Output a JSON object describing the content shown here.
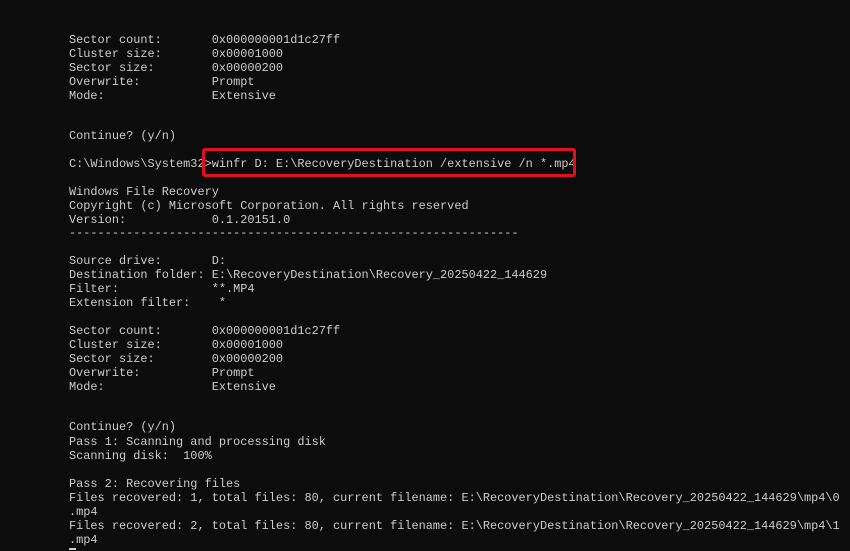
{
  "terminal": {
    "lines": [
      "Sector count:       0x000000001d1c27ff",
      "Cluster size:       0x00001000",
      "Sector size:        0x00000200",
      "Overwrite:          Prompt",
      "Mode:               Extensive",
      "Continue? (y/n)",
      "C:\\Windows\\System32>winfr D: E:\\RecoveryDestination /extensive /n *.mp4",
      "Windows File Recovery",
      "Copyright (c) Microsoft Corporation. All rights reserved",
      "Version:            0.1.20151.0",
      "---------------------------------------------------------------",
      "Source drive:       D:",
      "Destination folder: E:\\RecoveryDestination\\Recovery_20250422_144629",
      "Filter:             **.MP4",
      "Extension filter:    *",
      "Sector count:       0x000000001d1c27ff",
      "Cluster size:       0x00001000",
      "Sector size:        0x00000200",
      "Overwrite:          Prompt",
      "Mode:               Extensive",
      "Continue? (y/n)",
      "Pass 1: Scanning and processing disk",
      "Scanning disk:  100%",
      "Pass 2: Recovering files",
      "Files recovered: 1, total files: 80, current filename: E:\\RecoveryDestination\\Recovery_20250422_144629\\mp4\\0",
      ".mp4",
      "Files recovered: 2, total files: 80, current filename: E:\\RecoveryDestination\\Recovery_20250422_144629\\mp4\\1",
      ".mp4"
    ]
  },
  "colors": {
    "background": "#0c0c0c",
    "text": "#cccccc",
    "highlight": "#e0101c"
  }
}
